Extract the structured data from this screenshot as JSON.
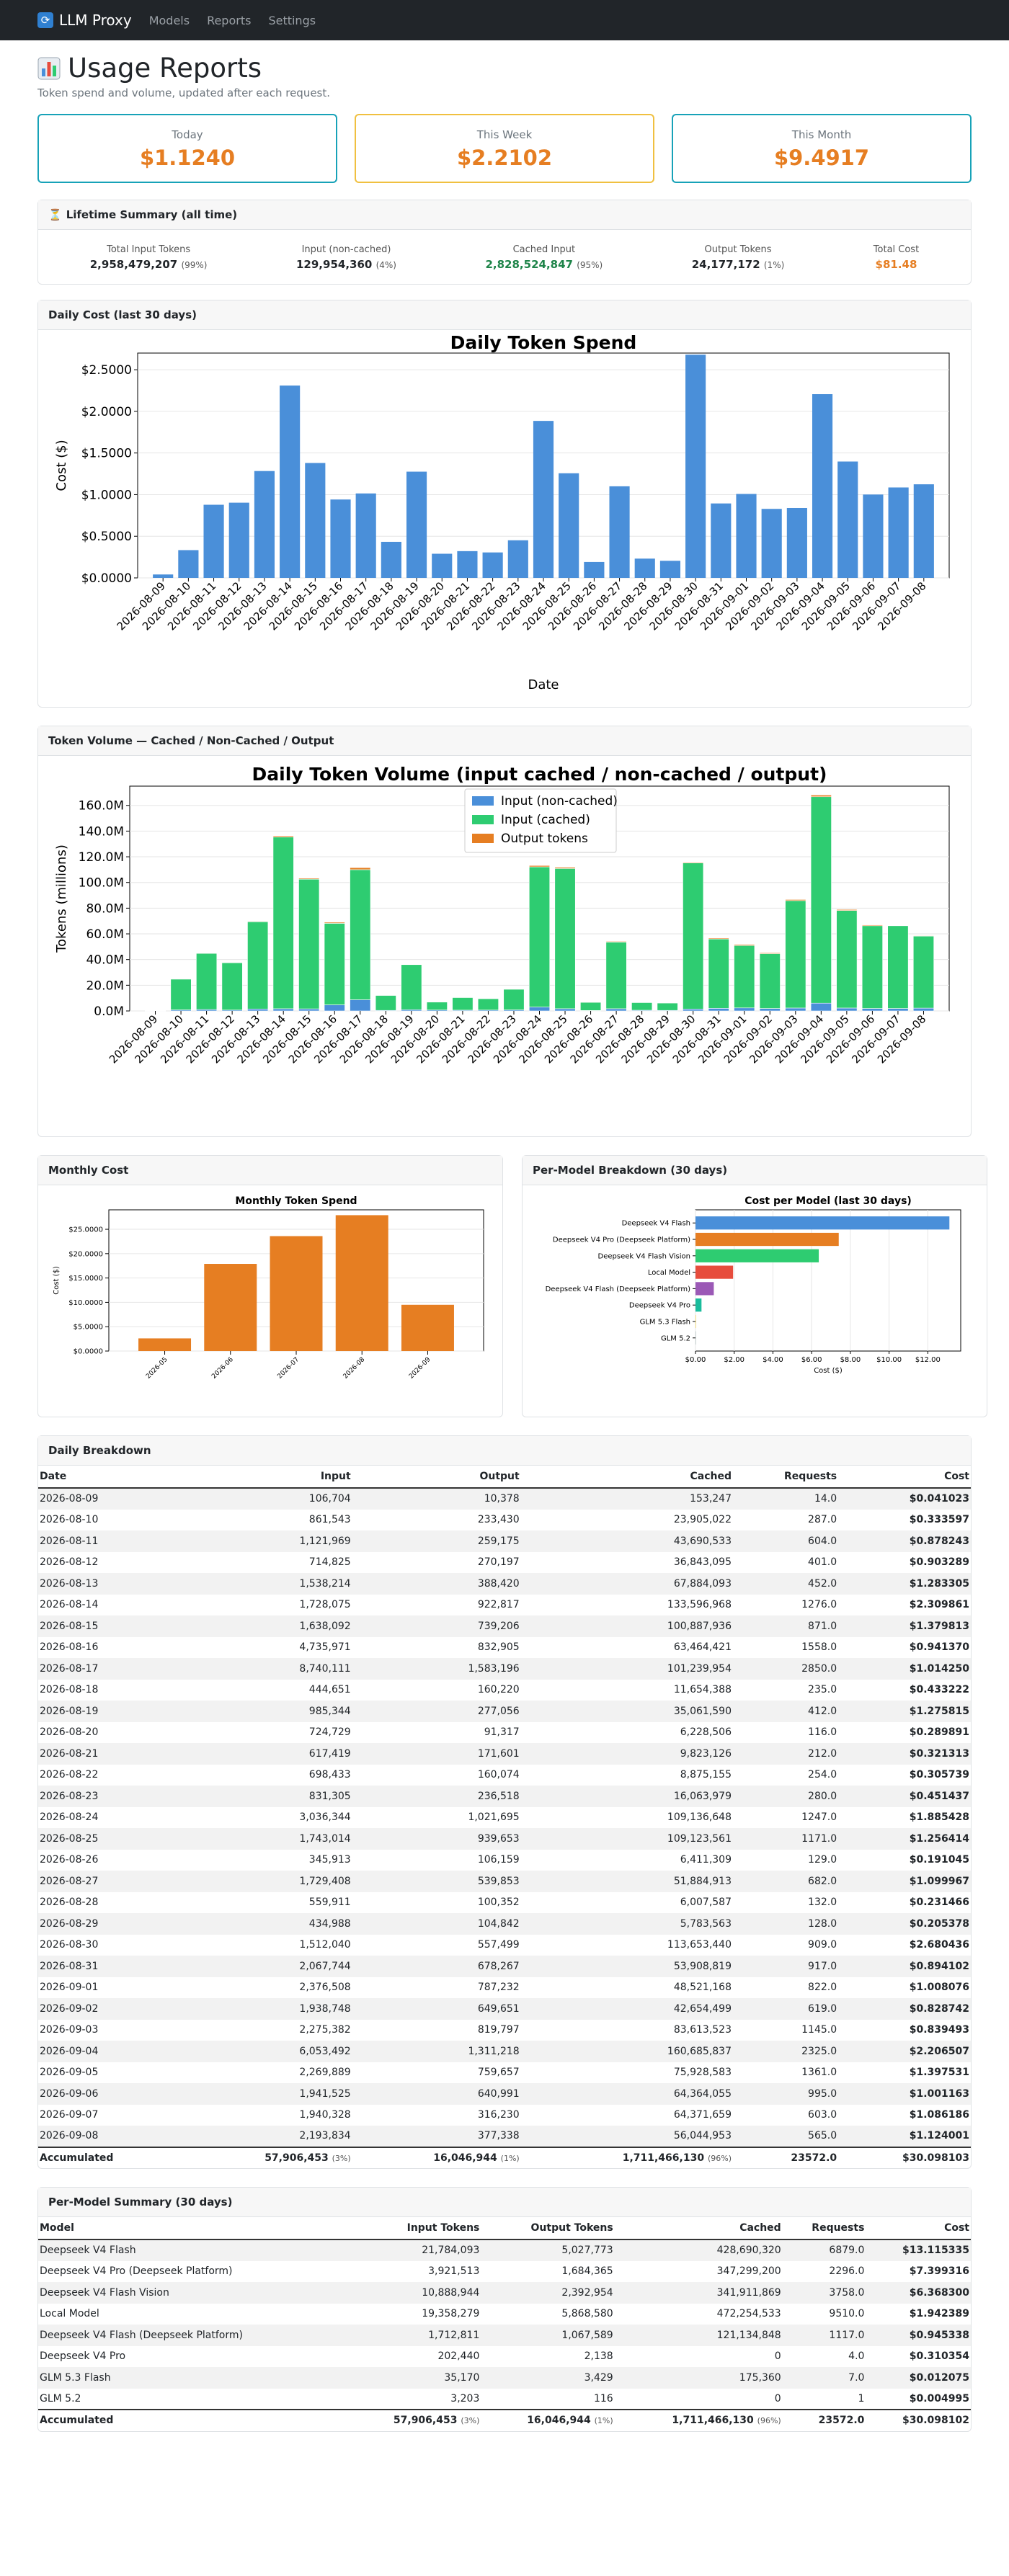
{
  "nav": {
    "brand": "LLM Proxy",
    "links": [
      "Models",
      "Reports",
      "Settings"
    ]
  },
  "page": {
    "title": "Usage Reports",
    "subtitle": "Token spend and volume, updated after each request."
  },
  "stats": [
    {
      "label": "Today",
      "value": "$1.1240",
      "color": "#17a2b8"
    },
    {
      "label": "This Week",
      "value": "$2.2102",
      "color": "#f0c040"
    },
    {
      "label": "This Month",
      "value": "$9.4917",
      "color": "#17a2b8"
    }
  ],
  "lifetime": {
    "header": "Lifetime Summary (all time)",
    "items": [
      {
        "label": "Total Input Tokens",
        "value": "2,958,479,207",
        "pct": "(99%)",
        "color": "#212529"
      },
      {
        "label": "Input (non-cached)",
        "value": "129,954,360",
        "pct": "(4%)",
        "color": "#212529"
      },
      {
        "label": "Cached Input",
        "value": "2,828,524,847",
        "pct": "(95%)",
        "color": "#1e8449"
      },
      {
        "label": "Output Tokens",
        "value": "24,177,172",
        "pct": "(1%)",
        "color": "#212529"
      },
      {
        "label": "Total Cost",
        "value": "$81.48",
        "pct": "",
        "color": "#e67e22"
      }
    ]
  },
  "dailyCostCard": {
    "header": "Daily Cost (last 30 days)"
  },
  "volumeCard": {
    "header": "Token Volume — Cached / Non-Cached / Output"
  },
  "monthlyCard": {
    "header": "Monthly Cost"
  },
  "modelCard": {
    "header": "Per-Model Breakdown (30 days)"
  },
  "chart_data": [
    {
      "type": "bar",
      "title": "Daily Token Spend",
      "xlabel": "Date",
      "ylabel": "Cost ($)",
      "ylim": [
        0,
        2.7
      ],
      "yticks": [
        "$0.0000",
        "$0.5000",
        "$1.0000",
        "$1.5000",
        "$2.0000",
        "$2.5000"
      ],
      "categories": [
        "2026-08-09",
        "2026-08-10",
        "2026-08-11",
        "2026-08-12",
        "2026-08-13",
        "2026-08-14",
        "2026-08-15",
        "2026-08-16",
        "2026-08-17",
        "2026-08-18",
        "2026-08-19",
        "2026-08-20",
        "2026-08-21",
        "2026-08-22",
        "2026-08-23",
        "2026-08-24",
        "2026-08-25",
        "2026-08-26",
        "2026-08-27",
        "2026-08-28",
        "2026-08-29",
        "2026-08-30",
        "2026-08-31",
        "2026-09-01",
        "2026-09-02",
        "2026-09-03",
        "2026-09-04",
        "2026-09-05",
        "2026-09-06",
        "2026-09-07",
        "2026-09-08"
      ],
      "values": [
        0.041023,
        0.333597,
        0.878243,
        0.903289,
        1.283305,
        2.309861,
        1.379813,
        0.94137,
        1.01425,
        0.433222,
        1.275815,
        0.289891,
        0.321313,
        0.305739,
        0.451437,
        1.885428,
        1.256414,
        0.191045,
        1.099967,
        0.231466,
        0.205378,
        2.680436,
        0.894102,
        1.008076,
        0.828742,
        0.839493,
        2.206507,
        1.397531,
        1.001163,
        1.086186,
        1.124001
      ],
      "color": "#4a8fd9",
      "grid": true
    },
    {
      "type": "bar",
      "stacked": true,
      "title": "Daily Token Volume (input cached / non-cached / output)",
      "ylabel": "Tokens (millions)",
      "ylim": [
        0,
        175
      ],
      "yticks": [
        "0.0M",
        "20.0M",
        "40.0M",
        "60.0M",
        "80.0M",
        "100.0M",
        "120.0M",
        "140.0M",
        "160.0M"
      ],
      "legend": "top-center",
      "categories": [
        "2026-08-09",
        "2026-08-10",
        "2026-08-11",
        "2026-08-12",
        "2026-08-13",
        "2026-08-14",
        "2026-08-15",
        "2026-08-16",
        "2026-08-17",
        "2026-08-18",
        "2026-08-19",
        "2026-08-20",
        "2026-08-21",
        "2026-08-22",
        "2026-08-23",
        "2026-08-24",
        "2026-08-25",
        "2026-08-26",
        "2026-08-27",
        "2026-08-28",
        "2026-08-29",
        "2026-08-30",
        "2026-08-31",
        "2026-09-01",
        "2026-09-02",
        "2026-09-03",
        "2026-09-04",
        "2026-09-05",
        "2026-09-06",
        "2026-09-07",
        "2026-09-08"
      ],
      "series": [
        {
          "name": "Input (non-cached)",
          "color": "#4a8fd9",
          "values": [
            0.107,
            0.862,
            1.122,
            0.715,
            1.538,
            1.728,
            1.638,
            4.736,
            8.74,
            0.445,
            0.985,
            0.725,
            0.617,
            0.698,
            0.831,
            3.036,
            1.743,
            0.346,
            1.729,
            0.56,
            0.435,
            1.512,
            2.068,
            2.377,
            1.939,
            2.275,
            6.053,
            2.27,
            1.942,
            1.94,
            2.194
          ]
        },
        {
          "name": "Input (cached)",
          "color": "#2ecc71",
          "values": [
            0.153,
            23.905,
            43.691,
            36.843,
            67.884,
            133.597,
            100.888,
            63.464,
            101.24,
            11.654,
            35.062,
            6.229,
            9.823,
            8.875,
            16.064,
            109.137,
            109.124,
            6.411,
            51.885,
            6.008,
            5.784,
            113.653,
            53.909,
            48.521,
            42.654,
            83.614,
            160.686,
            75.929,
            64.364,
            64.372,
            56.045
          ]
        },
        {
          "name": "Output tokens",
          "color": "#e67e22",
          "values": [
            0.01,
            0.233,
            0.259,
            0.27,
            0.388,
            0.923,
            0.739,
            0.833,
            1.584,
            0.16,
            0.277,
            0.091,
            0.172,
            0.16,
            0.237,
            1.022,
            0.94,
            0.106,
            0.54,
            0.1,
            0.105,
            0.557,
            0.678,
            0.787,
            0.65,
            0.82,
            1.311,
            0.76,
            0.641,
            0.316,
            0.377
          ]
        }
      ],
      "grid": true
    },
    {
      "type": "bar",
      "title": "Monthly Token Spend",
      "ylabel": "Cost ($)",
      "ylim": [
        0,
        29
      ],
      "yticks": [
        "$0.0000",
        "$5.0000",
        "$10.0000",
        "$15.0000",
        "$20.0000",
        "$25.0000"
      ],
      "categories": [
        "2026-05",
        "2026-06",
        "2026-07",
        "2026-08",
        "2026-09"
      ],
      "values": [
        2.6,
        17.9,
        23.6,
        27.9,
        9.5
      ],
      "color": "#e67e22"
    },
    {
      "type": "bar",
      "orientation": "horizontal",
      "title": "Cost per Model (last 30 days)",
      "xlabel": "Cost ($)",
      "xlim": [
        0,
        13.7
      ],
      "xticks": [
        "$0.00",
        "$2.00",
        "$4.00",
        "$6.00",
        "$8.00",
        "$10.00",
        "$12.00"
      ],
      "categories": [
        "Deepseek V4 Flash",
        "Deepseek V4 Pro (Deepseek Platform)",
        "Deepseek V4 Flash Vision",
        "Local Model",
        "Deepseek V4 Flash (Deepseek Platform)",
        "Deepseek V4 Pro",
        "GLM 5.3 Flash",
        "GLM 5.2"
      ],
      "values": [
        13.115335,
        7.399316,
        6.3683,
        1.942389,
        0.945338,
        0.310354,
        0.012075,
        0.004995
      ],
      "colors": [
        "#4a8fd9",
        "#e67e22",
        "#2ecc71",
        "#e74c3c",
        "#9b59b6",
        "#1abc9c",
        "#f1c40f",
        "#95a5a6"
      ]
    }
  ],
  "dailyTable": {
    "header": "Daily Breakdown",
    "columns": [
      "Date",
      "Input",
      "Output",
      "Cached",
      "Requests",
      "Cost"
    ],
    "rows": [
      [
        "2026-08-09",
        "106,704",
        "10,378",
        "153,247",
        "14.0",
        "$0.041023"
      ],
      [
        "2026-08-10",
        "861,543",
        "233,430",
        "23,905,022",
        "287.0",
        "$0.333597"
      ],
      [
        "2026-08-11",
        "1,121,969",
        "259,175",
        "43,690,533",
        "604.0",
        "$0.878243"
      ],
      [
        "2026-08-12",
        "714,825",
        "270,197",
        "36,843,095",
        "401.0",
        "$0.903289"
      ],
      [
        "2026-08-13",
        "1,538,214",
        "388,420",
        "67,884,093",
        "452.0",
        "$1.283305"
      ],
      [
        "2026-08-14",
        "1,728,075",
        "922,817",
        "133,596,968",
        "1276.0",
        "$2.309861"
      ],
      [
        "2026-08-15",
        "1,638,092",
        "739,206",
        "100,887,936",
        "871.0",
        "$1.379813"
      ],
      [
        "2026-08-16",
        "4,735,971",
        "832,905",
        "63,464,421",
        "1558.0",
        "$0.941370"
      ],
      [
        "2026-08-17",
        "8,740,111",
        "1,583,196",
        "101,239,954",
        "2850.0",
        "$1.014250"
      ],
      [
        "2026-08-18",
        "444,651",
        "160,220",
        "11,654,388",
        "235.0",
        "$0.433222"
      ],
      [
        "2026-08-19",
        "985,344",
        "277,056",
        "35,061,590",
        "412.0",
        "$1.275815"
      ],
      [
        "2026-08-20",
        "724,729",
        "91,317",
        "6,228,506",
        "116.0",
        "$0.289891"
      ],
      [
        "2026-08-21",
        "617,419",
        "171,601",
        "9,823,126",
        "212.0",
        "$0.321313"
      ],
      [
        "2026-08-22",
        "698,433",
        "160,074",
        "8,875,155",
        "254.0",
        "$0.305739"
      ],
      [
        "2026-08-23",
        "831,305",
        "236,518",
        "16,063,979",
        "280.0",
        "$0.451437"
      ],
      [
        "2026-08-24",
        "3,036,344",
        "1,021,695",
        "109,136,648",
        "1247.0",
        "$1.885428"
      ],
      [
        "2026-08-25",
        "1,743,014",
        "939,653",
        "109,123,561",
        "1171.0",
        "$1.256414"
      ],
      [
        "2026-08-26",
        "345,913",
        "106,159",
        "6,411,309",
        "129.0",
        "$0.191045"
      ],
      [
        "2026-08-27",
        "1,729,408",
        "539,853",
        "51,884,913",
        "682.0",
        "$1.099967"
      ],
      [
        "2026-08-28",
        "559,911",
        "100,352",
        "6,007,587",
        "132.0",
        "$0.231466"
      ],
      [
        "2026-08-29",
        "434,988",
        "104,842",
        "5,783,563",
        "128.0",
        "$0.205378"
      ],
      [
        "2026-08-30",
        "1,512,040",
        "557,499",
        "113,653,440",
        "909.0",
        "$2.680436"
      ],
      [
        "2026-08-31",
        "2,067,744",
        "678,267",
        "53,908,819",
        "917.0",
        "$0.894102"
      ],
      [
        "2026-09-01",
        "2,376,508",
        "787,232",
        "48,521,168",
        "822.0",
        "$1.008076"
      ],
      [
        "2026-09-02",
        "1,938,748",
        "649,651",
        "42,654,499",
        "619.0",
        "$0.828742"
      ],
      [
        "2026-09-03",
        "2,275,382",
        "819,797",
        "83,613,523",
        "1145.0",
        "$0.839493"
      ],
      [
        "2026-09-04",
        "6,053,492",
        "1,311,218",
        "160,685,837",
        "2325.0",
        "$2.206507"
      ],
      [
        "2026-09-05",
        "2,269,889",
        "759,657",
        "75,928,583",
        "1361.0",
        "$1.397531"
      ],
      [
        "2026-09-06",
        "1,941,525",
        "640,991",
        "64,364,055",
        "995.0",
        "$1.001163"
      ],
      [
        "2026-09-07",
        "1,940,328",
        "316,230",
        "64,371,659",
        "603.0",
        "$1.086186"
      ],
      [
        "2026-09-08",
        "2,193,834",
        "377,338",
        "56,044,953",
        "565.0",
        "$1.124001"
      ]
    ],
    "footer": {
      "label": "Accumulated",
      "input": "57,906,453",
      "input_pct": "(3%)",
      "output": "16,046,944",
      "output_pct": "(1%)",
      "cached": "1,711,466,130",
      "cached_pct": "(96%)",
      "requests": "23572.0",
      "cost": "$30.098103"
    }
  },
  "modelTable": {
    "header": "Per-Model Summary (30 days)",
    "columns": [
      "Model",
      "Input Tokens",
      "Output Tokens",
      "Cached",
      "Requests",
      "Cost"
    ],
    "rows": [
      [
        "Deepseek V4 Flash",
        "21,784,093",
        "5,027,773",
        "428,690,320",
        "6879.0",
        "$13.115335"
      ],
      [
        "Deepseek V4 Pro (Deepseek Platform)",
        "3,921,513",
        "1,684,365",
        "347,299,200",
        "2296.0",
        "$7.399316"
      ],
      [
        "Deepseek V4 Flash Vision",
        "10,888,944",
        "2,392,954",
        "341,911,869",
        "3758.0",
        "$6.368300"
      ],
      [
        "Local Model",
        "19,358,279",
        "5,868,580",
        "472,254,533",
        "9510.0",
        "$1.942389"
      ],
      [
        "Deepseek V4 Flash (Deepseek Platform)",
        "1,712,811",
        "1,067,589",
        "121,134,848",
        "1117.0",
        "$0.945338"
      ],
      [
        "Deepseek V4 Pro",
        "202,440",
        "2,138",
        "0",
        "4.0",
        "$0.310354"
      ],
      [
        "GLM 5.3 Flash",
        "35,170",
        "3,429",
        "175,360",
        "7.0",
        "$0.012075"
      ],
      [
        "GLM 5.2",
        "3,203",
        "116",
        "0",
        "1",
        "$0.004995"
      ]
    ],
    "footer": {
      "label": "Accumulated",
      "input": "57,906,453",
      "input_pct": "(3%)",
      "output": "16,046,944",
      "output_pct": "(1%)",
      "cached": "1,711,466,130",
      "cached_pct": "(96%)",
      "requests": "23572.0",
      "cost": "$30.098102"
    }
  }
}
